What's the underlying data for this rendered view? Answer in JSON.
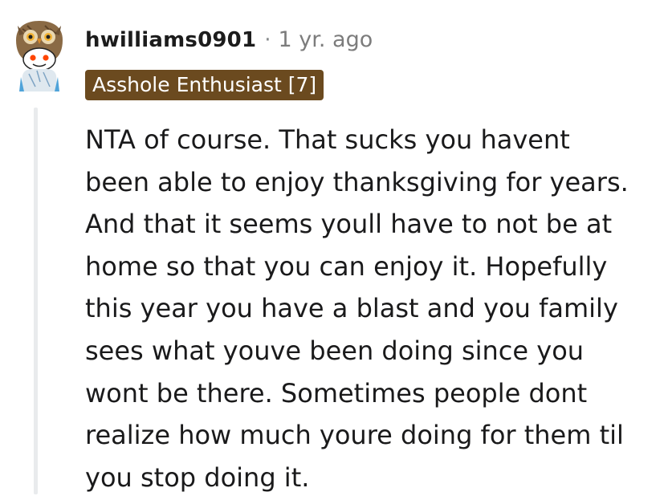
{
  "comment": {
    "username": "hwilliams0901",
    "separator": "·",
    "time_ago": "1 yr. ago",
    "flair": "Asshole Enthusiast [7]",
    "body_lines": [
      "NTA of course. That sucks you havent",
      "been able to enjoy thanksgiving for years.",
      "And that it seems youll have to not be at",
      "home so that you can enjoy it. Hopefully",
      "this year you have a blast and you family",
      "sees what youve been doing since you",
      "wont be there. Sometimes people dont",
      "realize how much youre doing for them til",
      "you stop doing it."
    ]
  },
  "colors": {
    "flair_background": "#6b4a1f",
    "flair_text": "#ffffff",
    "thread_line": "#e9ebed",
    "meta_gray": "#7c7c7c"
  },
  "icons": {
    "avatar": "owl-snoo-avatar-icon"
  }
}
